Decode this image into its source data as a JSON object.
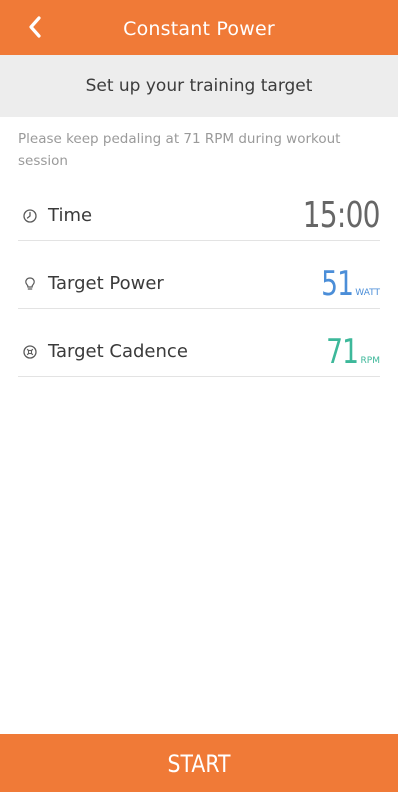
{
  "header": {
    "title": "Constant Power",
    "back_icon": "chevron-left-icon"
  },
  "subheader": {
    "text": "Set up your training target"
  },
  "hint": {
    "text": "Please keep pedaling at 71 RPM during workout session"
  },
  "settings": {
    "time": {
      "label": "Time",
      "value": "15:00",
      "icon": "clock-icon"
    },
    "target_power": {
      "label": "Target Power",
      "value": "51",
      "unit": "WATT",
      "icon": "lightbulb-icon",
      "color": "#4b8ed8"
    },
    "target_cadence": {
      "label": "Target Cadence",
      "value": "71",
      "unit": "RPM",
      "icon": "cadence-icon",
      "color": "#3db89a"
    }
  },
  "footer": {
    "start_label": "START"
  },
  "colors": {
    "accent": "#f07a37",
    "subheader_bg": "#ededed"
  }
}
